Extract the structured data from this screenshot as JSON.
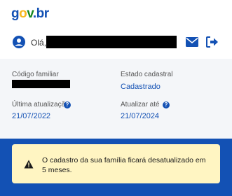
{
  "header": {
    "logo_text": "gov.br",
    "brand_colors": {
      "blue": "#1351b4",
      "yellow": "#f8b81f",
      "green": "#168821"
    }
  },
  "user": {
    "greeting": "Olá,",
    "icons": {
      "user": "user-circle-icon",
      "mail": "mail-icon",
      "logout": "logout-icon"
    }
  },
  "family": {
    "codigo_label": "Código familiar",
    "estado_label": "Estado cadastral",
    "estado_value": "Cadastrado",
    "ultima_label": "Última atualização",
    "ultima_value": "21/07/2022",
    "atualizar_label": "Atualizar até",
    "atualizar_value": "21/07/2024"
  },
  "alert": {
    "message": "O cadastro da sua família ficará desatualizado em 5 meses.",
    "icon": "warning-icon"
  }
}
